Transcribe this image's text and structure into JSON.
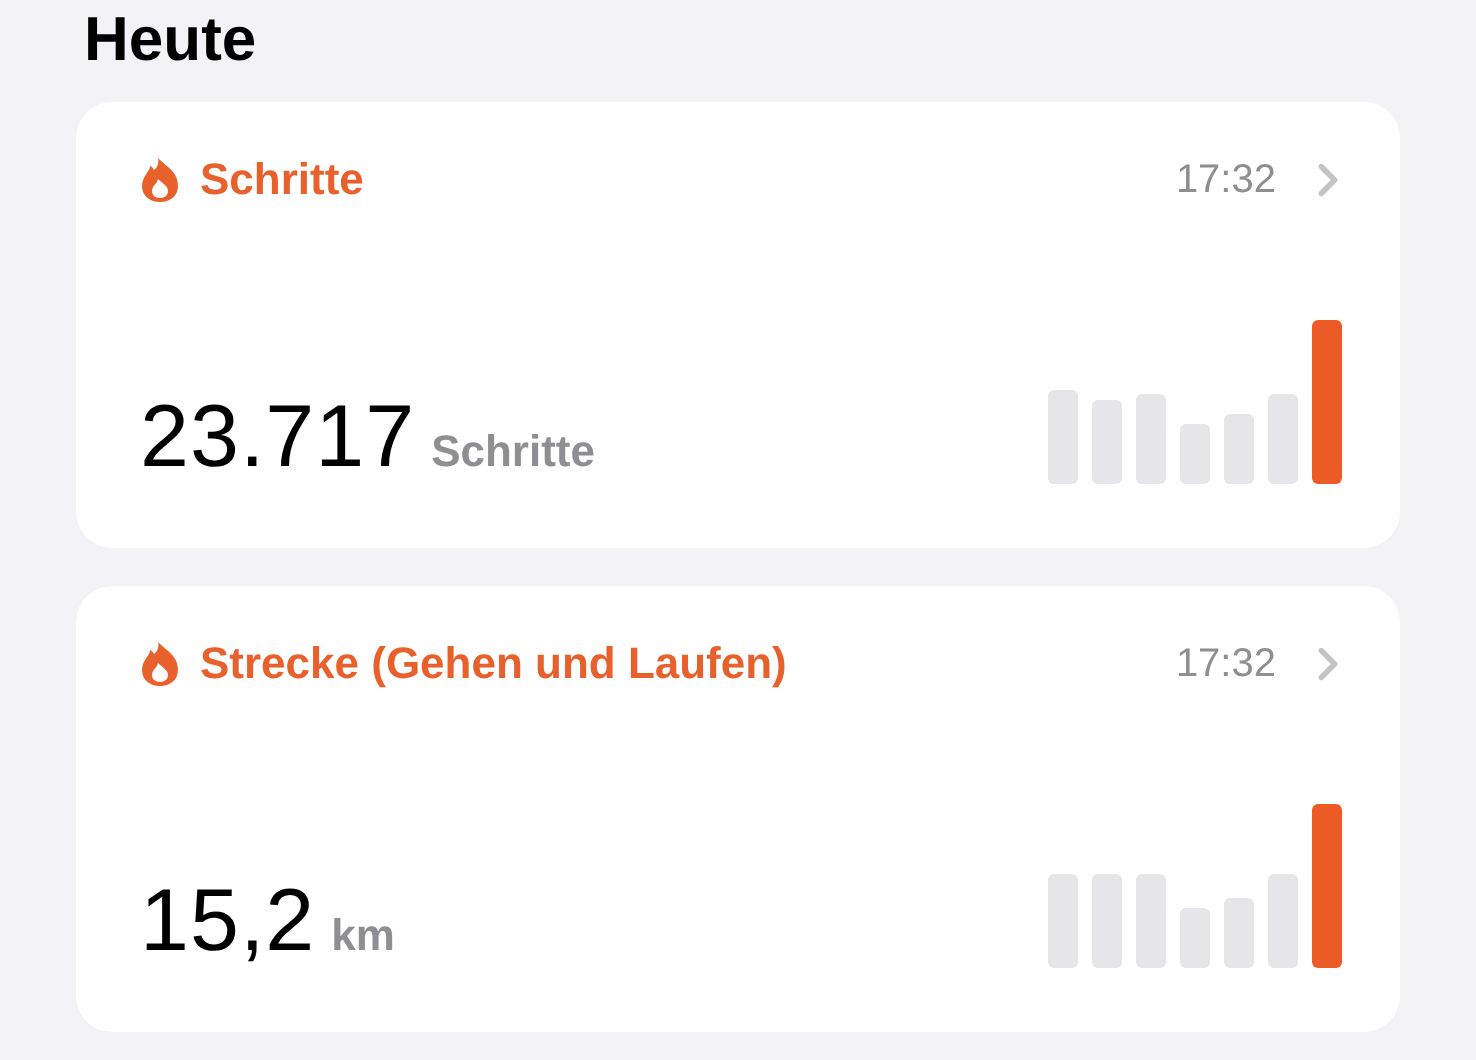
{
  "heading": "Heute",
  "cards": [
    {
      "title": "Schritte",
      "time": "17:32",
      "value": "23.717",
      "unit": "Schritte"
    },
    {
      "title": "Strecke (Gehen und Laufen)",
      "time": "17:32",
      "value": "15,2",
      "unit": "km"
    }
  ]
}
